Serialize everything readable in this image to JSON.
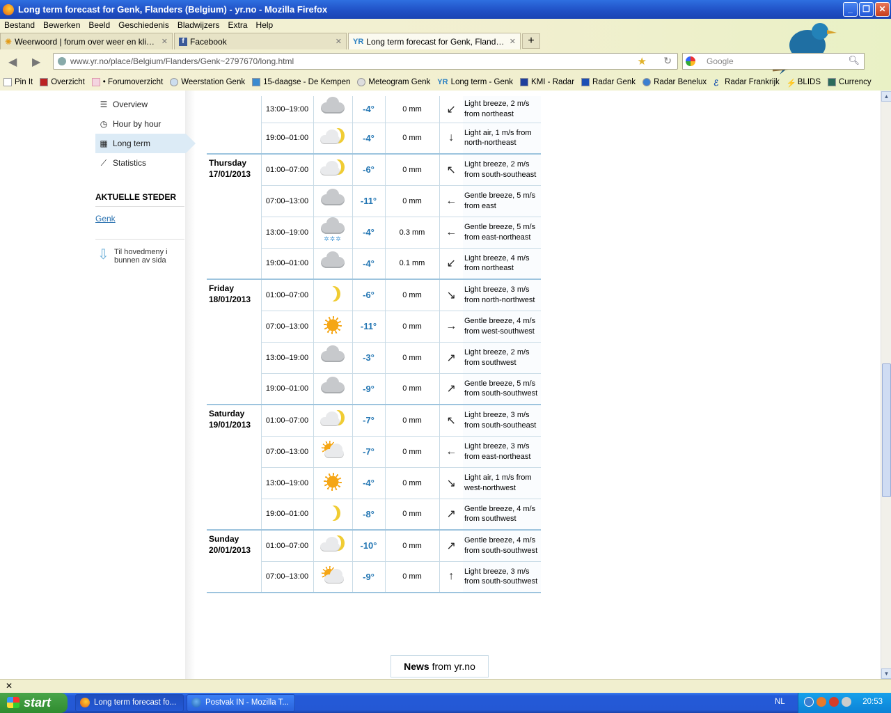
{
  "window": {
    "title": "Long term forecast for Genk, Flanders (Belgium) - yr.no - Mozilla Firefox",
    "minimize": "_",
    "maximize": "❐",
    "close": "✕"
  },
  "menu": [
    "Bestand",
    "Bewerken",
    "Beeld",
    "Geschiedenis",
    "Bladwijzers",
    "Extra",
    "Help"
  ],
  "tabs": [
    {
      "label": "Weerwoord | forum over weer en klimaat...",
      "active": false
    },
    {
      "label": "Facebook",
      "active": false
    },
    {
      "label": "Long term forecast for Genk, Flanders (B...",
      "active": true
    }
  ],
  "new_tab": "+",
  "url": "www.yr.no/place/Belgium/Flanders/Genk~2797670/long.html",
  "search_placeholder": "Google",
  "bookmarks": [
    "Pin It",
    "Overzicht",
    "• Forumoverzicht",
    "Weerstation Genk",
    "15-daagse - De Kempen",
    "Meteogram Genk",
    "Long term - Genk",
    "KMI - Radar",
    "Radar Genk",
    "Radar Benelux",
    "Radar Frankrijk",
    "BLIDS",
    "Currency"
  ],
  "sidenav": {
    "items": [
      {
        "label": "Overview",
        "icon": "list-icon",
        "glyph": "☰"
      },
      {
        "label": "Hour by hour",
        "icon": "clock-icon",
        "glyph": "◷"
      },
      {
        "label": "Long term",
        "icon": "calendar-icon",
        "glyph": "▦"
      },
      {
        "label": "Statistics",
        "icon": "chart-icon",
        "glyph": "⟋"
      }
    ],
    "active_index": 2,
    "aktuelle_heading": "AKTUELLE STEDER",
    "place_link": "Genk",
    "back_to_menu": "Til hovedmeny i bunnen av sida"
  },
  "forecast": [
    {
      "day": "",
      "date": "",
      "time": "13:00–19:00",
      "icon": "cloudy",
      "temp": "-4°",
      "precip": "0 mm",
      "wind_arrow": "↙",
      "wind": "Light breeze, 2 m/s from northeast"
    },
    {
      "day": "",
      "date": "",
      "time": "19:00–01:00",
      "icon": "partly-cloudy-night",
      "temp": "-4°",
      "precip": "0 mm",
      "wind_arrow": "↓",
      "wind": "Light air, 1 m/s from north-northeast"
    },
    {
      "day": "Thursday",
      "date": "17/01/2013",
      "time": "01:00–07:00",
      "icon": "partly-cloudy-night",
      "temp": "-6°",
      "precip": "0 mm",
      "wind_arrow": "↖",
      "wind": "Light breeze, 2 m/s from south-southeast"
    },
    {
      "day": "",
      "date": "",
      "time": "07:00–13:00",
      "icon": "cloudy",
      "temp": "-11°",
      "precip": "0 mm",
      "wind_arrow": "←",
      "wind": "Gentle breeze, 5 m/s from east"
    },
    {
      "day": "",
      "date": "",
      "time": "13:00–19:00",
      "icon": "snow",
      "temp": "-4°",
      "precip": "0.3 mm",
      "wind_arrow": "←",
      "wind": "Gentle breeze, 5 m/s from east-northeast"
    },
    {
      "day": "",
      "date": "",
      "time": "19:00–01:00",
      "icon": "cloudy",
      "temp": "-4°",
      "precip": "0.1 mm",
      "wind_arrow": "↙",
      "wind": "Light breeze, 4 m/s from northeast"
    },
    {
      "day": "Friday",
      "date": "18/01/2013",
      "time": "01:00–07:00",
      "icon": "clear-night",
      "temp": "-6°",
      "precip": "0 mm",
      "wind_arrow": "↘",
      "wind": "Light breeze, 3 m/s from north-northwest"
    },
    {
      "day": "",
      "date": "",
      "time": "07:00–13:00",
      "icon": "sun",
      "temp": "-11°",
      "precip": "0 mm",
      "wind_arrow": "→",
      "wind": "Gentle breeze, 4 m/s from west-southwest"
    },
    {
      "day": "",
      "date": "",
      "time": "13:00–19:00",
      "icon": "cloudy",
      "temp": "-3°",
      "precip": "0 mm",
      "wind_arrow": "↗",
      "wind": "Light breeze, 2 m/s from southwest"
    },
    {
      "day": "",
      "date": "",
      "time": "19:00–01:00",
      "icon": "cloudy",
      "temp": "-9°",
      "precip": "0 mm",
      "wind_arrow": "↗",
      "wind": "Gentle breeze, 5 m/s from south-southwest"
    },
    {
      "day": "Saturday",
      "date": "19/01/2013",
      "time": "01:00–07:00",
      "icon": "partly-cloudy-night",
      "temp": "-7°",
      "precip": "0 mm",
      "wind_arrow": "↖",
      "wind": "Light breeze, 3 m/s from south-southeast"
    },
    {
      "day": "",
      "date": "",
      "time": "07:00–13:00",
      "icon": "partly-cloudy-day",
      "temp": "-7°",
      "precip": "0 mm",
      "wind_arrow": "←",
      "wind": "Light breeze, 3 m/s from east-northeast"
    },
    {
      "day": "",
      "date": "",
      "time": "13:00–19:00",
      "icon": "sun",
      "temp": "-4°",
      "precip": "0 mm",
      "wind_arrow": "↘",
      "wind": "Light air, 1 m/s from west-northwest"
    },
    {
      "day": "",
      "date": "",
      "time": "19:00–01:00",
      "icon": "clear-night",
      "temp": "-8°",
      "precip": "0 mm",
      "wind_arrow": "↗",
      "wind": "Gentle breeze, 4 m/s from southwest"
    },
    {
      "day": "Sunday",
      "date": "20/01/2013",
      "time": "01:00–07:00",
      "icon": "partly-cloudy-night",
      "temp": "-10°",
      "precip": "0 mm",
      "wind_arrow": "↗",
      "wind": "Gentle breeze, 4 m/s from south-southwest"
    },
    {
      "day": "",
      "date": "",
      "time": "07:00–13:00",
      "icon": "partly-cloudy-day",
      "temp": "-9°",
      "precip": "0 mm",
      "wind_arrow": "↑",
      "wind": "Light breeze, 3 m/s from south-southwest"
    }
  ],
  "news": {
    "strong": "News",
    "rest": " from yr.no"
  },
  "statusbar_close": "✕",
  "taskbar": {
    "start": "start",
    "items": [
      {
        "label": "Long term forecast fo...",
        "active": true
      },
      {
        "label": "Postvak IN - Mozilla T...",
        "active": false
      }
    ],
    "lang": "NL",
    "clock": "20:53"
  },
  "colors": {
    "accent": "#2376b3",
    "link": "#2a72b0",
    "taskbar": "#245ad8"
  }
}
